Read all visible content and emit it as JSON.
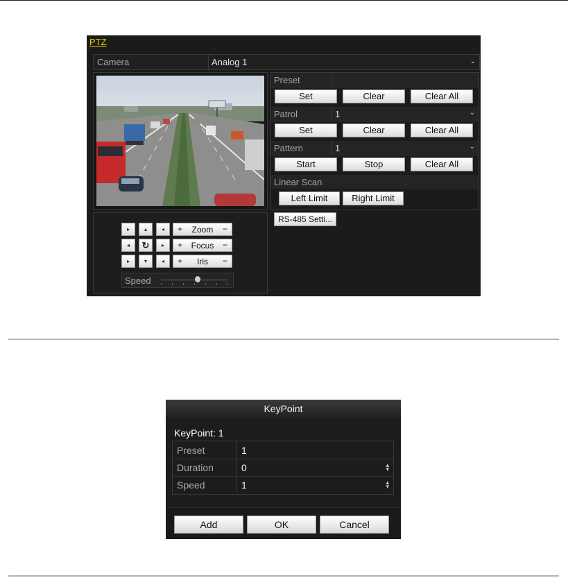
{
  "ptz": {
    "title": "PTZ",
    "camera_label": "Camera",
    "camera_value": "Analog 1",
    "preset": {
      "label": "Preset",
      "buttons": [
        "Set",
        "Clear",
        "Clear All"
      ]
    },
    "patrol": {
      "label": "Patrol",
      "value": "1",
      "buttons": [
        "Set",
        "Clear",
        "Clear All"
      ]
    },
    "pattern": {
      "label": "Pattern",
      "value": "1",
      "buttons": [
        "Start",
        "Stop",
        "Clear All"
      ]
    },
    "linear_scan": {
      "label": "Linear Scan",
      "buttons": [
        "Left Limit",
        "Right Limit"
      ]
    },
    "rs485_button": "RS-485 Setti...",
    "lens": {
      "zoom": "Zoom",
      "focus": "Focus",
      "iris": "Iris",
      "plus": "+",
      "minus": "−"
    },
    "speed_label": "Speed",
    "speed_level_fraction": 0.55,
    "icons": {
      "up_left": "▸",
      "up": "▴",
      "up_right": "◂",
      "left": "◂",
      "center": "↻",
      "right": "▸",
      "down_left": "▸",
      "down": "▾",
      "down_right": "◂"
    },
    "colors": {
      "title": "#f0d000",
      "panel": "#1b1b1b"
    }
  },
  "keypoint": {
    "title": "KeyPoint",
    "subtitle": "KeyPoint: 1",
    "rows": [
      {
        "label": "Preset",
        "value": "1"
      },
      {
        "label": "Duration",
        "value": "0"
      },
      {
        "label": "Speed",
        "value": "1"
      }
    ],
    "buttons": {
      "add": "Add",
      "ok": "OK",
      "cancel": "Cancel"
    }
  }
}
